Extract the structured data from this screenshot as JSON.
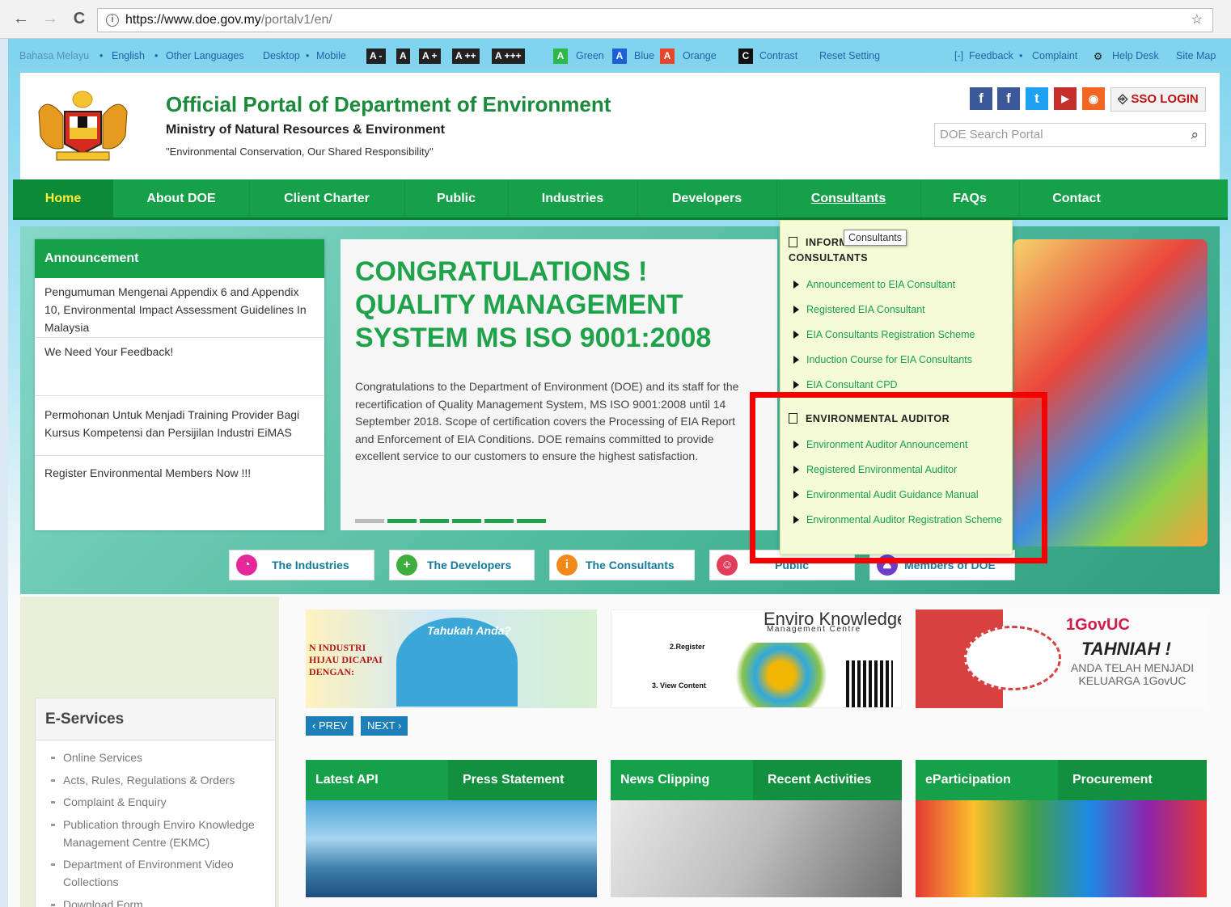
{
  "browser": {
    "back": "←",
    "forward": "→",
    "reload": "C",
    "url_host": "https://www.doe.gov.my",
    "url_path": "/portalv1/en/",
    "info": "i"
  },
  "topbar": {
    "lang_malay": "Bahasa Melayu",
    "lang_english": "English",
    "other_languages": "Other Languages",
    "desktop": "Desktop",
    "mobile": "Mobile",
    "sep": "•",
    "sizes": [
      "A -",
      "A",
      "A +",
      "A ++",
      "A +++"
    ],
    "colors": [
      {
        "letter": "A",
        "label": "Green",
        "hex": "#2db84b"
      },
      {
        "letter": "A",
        "label": "Blue",
        "hex": "#1f5fd6"
      },
      {
        "letter": "A",
        "label": "Orange",
        "hex": "#e8462b"
      }
    ],
    "contrast_letter": "C",
    "contrast": "Contrast",
    "reset": "Reset Setting",
    "feedback_icon": "[-]",
    "feedback": "Feedback",
    "complaint": "Complaint",
    "helpdesk": "Help Desk",
    "sitemap": "Site Map"
  },
  "header": {
    "title": "Official Portal of Department of Environment",
    "ministry": "Ministry of Natural Resources & Environment",
    "tagline": "\"Environmental Conservation, Our Shared Responsibility\"",
    "sso": "SSO LOGIN",
    "search_placeholder": "DOE Search Portal",
    "social": [
      {
        "icon": "facebook-icon",
        "glyph": "f",
        "hex": "#3b5998"
      },
      {
        "icon": "facebook-icon",
        "glyph": "f",
        "hex": "#3b5998"
      },
      {
        "icon": "twitter-icon",
        "glyph": "t",
        "hex": "#1da1f2"
      },
      {
        "icon": "youtube-icon",
        "glyph": "▶",
        "hex": "#c4302b"
      },
      {
        "icon": "rss-icon",
        "glyph": "◉",
        "hex": "#f26522"
      }
    ]
  },
  "nav": [
    "Home",
    "About DOE",
    "Client Charter",
    "Public",
    "Industries",
    "Developers",
    "Consultants",
    "FAQs",
    "Contact"
  ],
  "announcement": {
    "title": "Announcement",
    "items": [
      "Pengumuman Mengenai Appendix 6 and Appendix 10, Environmental Impact Assessment Guidelines In Malaysia",
      "We Need Your Feedback!",
      "Permohonan Untuk Menjadi Training Provider Bagi Kursus Kompetensi dan Persijilan Industri EiMAS",
      "Register Environmental Members Now !!!"
    ]
  },
  "slide": {
    "title": "CONGRATULATIONS ! QUALITY MANAGEMENT SYSTEM MS ISO 9001:2008",
    "text": "Congratulations to the Department of Environment (DOE) and its staff for the recertification of Quality Management System, MS ISO 9001:2008 until 14 September 2018. Scope of certification covers the Processing of EIA Report and Enforcement of EIA Conditions. DOE remains committed to provide excellent service to our customers to ensure the highest satisfaction."
  },
  "dropdown": {
    "tooltip": "Consultants",
    "section1": "INFORMATION FOR CONSULTANTS",
    "links1": [
      "Announcement to EIA Consultant",
      "Registered EIA Consultant",
      "EIA Consultants Registration Scheme",
      "Induction Course for EIA Consultants",
      "EIA Consultant CPD"
    ],
    "section2": "ENVIRONMENTAL AUDITOR",
    "links2": [
      "Environment Auditor Announcement",
      "Registered Environmental Auditor",
      "Environmental Audit Guidance Manual",
      "Environmental Auditor Registration Scheme"
    ]
  },
  "quick": [
    {
      "label": "The Industries",
      "hex": "#e4289a"
    },
    {
      "label": "The Developers",
      "hex": "#3fae3f"
    },
    {
      "label": "The Consultants",
      "hex": "#f28a1b"
    },
    {
      "label": "Public",
      "hex": "#e23d5a"
    },
    {
      "label": "Members of DOE",
      "hex": "#6d3ec7"
    }
  ],
  "eservices": {
    "title": "E-Services",
    "items": [
      "Online Services",
      "Acts, Rules, Regulations & Orders",
      "Complaint & Enquiry",
      "Publication through Enviro Knowledge Management Centre (EKMC)",
      "Department of Environment Video Collections",
      "Download Form"
    ]
  },
  "banners": {
    "b1_title": "Tahukah Anda?",
    "b1_left": "N INDUSTRI HIJAU DICAPAI DENGAN:",
    "b2_title": "Enviro Knowledge",
    "b2_sub": "Management Centre",
    "b2_register": "2.Register",
    "b2_view": "3. View Content",
    "b3_logo": "1GovUC",
    "b3_title": "TAHNIAH !",
    "b3_sub": "ANDA TELAH MENJADI KELUARGA 1GovUC"
  },
  "pager": {
    "prev": "PREV",
    "next": "NEXT"
  },
  "tabs": [
    "Latest API",
    "Press Statement",
    "News Clipping",
    "Recent Activities",
    "eParticipation",
    "Procurement"
  ]
}
